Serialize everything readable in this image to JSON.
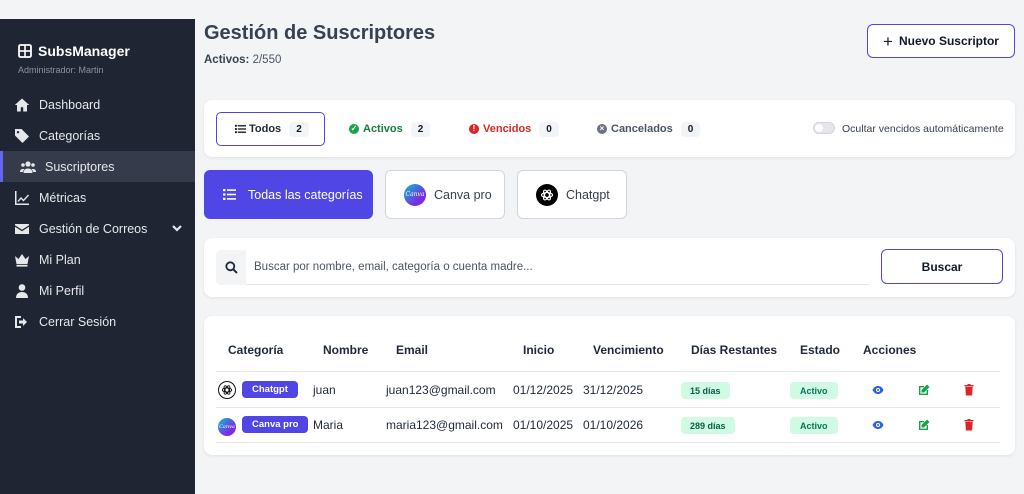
{
  "sidebar": {
    "brand": "SubsManager",
    "subtitle": "Administrador: Martin",
    "items": [
      {
        "label": "Dashboard",
        "icon": "home-icon"
      },
      {
        "label": "Categorías",
        "icon": "tag-icon"
      },
      {
        "label": "Suscriptores",
        "icon": "users-icon",
        "active": true
      },
      {
        "label": "Métricas",
        "icon": "chart-line-icon"
      },
      {
        "label": "Gestión de Correos",
        "icon": "envelope-icon"
      },
      {
        "label": "Mi Plan",
        "icon": "crown-icon"
      },
      {
        "label": "Mi Perfil",
        "icon": "user-icon"
      },
      {
        "label": "Cerrar Sesión",
        "icon": "sign-out-icon"
      }
    ]
  },
  "header": {
    "title": "Gestión de Suscriptores",
    "active_label": "Activos:",
    "active_value": "2/550",
    "new_button": "Nuevo Suscriptor"
  },
  "filters": {
    "tabs": [
      {
        "label": "Todos",
        "count": "2",
        "color": "#111827"
      },
      {
        "label": "Activos",
        "count": "2",
        "color": "#15803d"
      },
      {
        "label": "Vencidos",
        "count": "0",
        "color": "#dc2626"
      },
      {
        "label": "Cancelados",
        "count": "0",
        "color": "#4b5563"
      }
    ],
    "toggle_label": "Ocultar vencidos automáticamente"
  },
  "categories": {
    "all_label": "Todas las categorías",
    "items": [
      {
        "label": "Canva pro"
      },
      {
        "label": "Chatgpt"
      }
    ]
  },
  "search": {
    "placeholder": "Buscar por nombre, email, categoría o cuenta madre...",
    "value": "",
    "button": "Buscar"
  },
  "table": {
    "columns": [
      "Categoría",
      "Nombre",
      "Email",
      "Inicio",
      "Vencimiento",
      "Días Restantes",
      "Estado",
      "Acciones"
    ],
    "rows": [
      {
        "category": "Chatgpt",
        "name": "juan",
        "email": "juan123@gmail.com",
        "start": "01/12/2025",
        "end": "31/12/2025",
        "days": "15 días",
        "state": "Activo"
      },
      {
        "category": "Canva pro",
        "name": "Maria",
        "email": "maria123@gmail.com",
        "start": "01/10/2025",
        "end": "01/10/2026",
        "days": "289 días",
        "state": "Activo"
      }
    ]
  },
  "colors": {
    "accent": "#4f46e5",
    "sidebar_bg": "#1f2533",
    "success_bg": "#d1fae5",
    "view": "#2563eb",
    "edit": "#16a34a",
    "delete": "#dc2626"
  }
}
